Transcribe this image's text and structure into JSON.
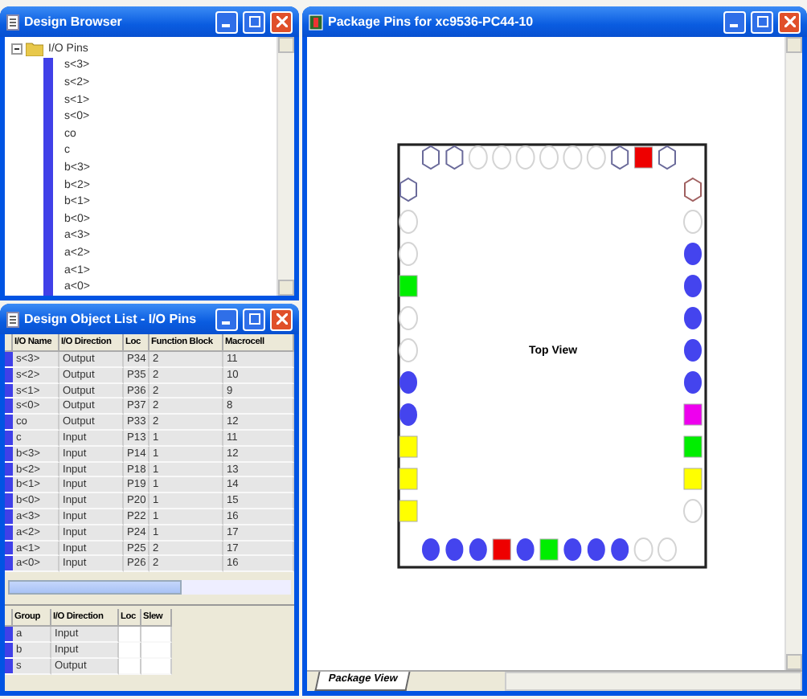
{
  "browser": {
    "title": "Design Browser",
    "tree": {
      "label": "I/O Pins",
      "expanded": true,
      "children": [
        {
          "label": "s<3>"
        },
        {
          "label": "s<2>"
        },
        {
          "label": "s<1>"
        },
        {
          "label": "s<0>"
        },
        {
          "label": "co"
        },
        {
          "label": "c"
        },
        {
          "label": "b<3>"
        },
        {
          "label": "b<2>"
        },
        {
          "label": "b<1>"
        },
        {
          "label": "b<0>"
        },
        {
          "label": "a<3>"
        },
        {
          "label": "a<2>"
        },
        {
          "label": "a<1>"
        },
        {
          "label": "a<0>"
        }
      ]
    }
  },
  "object_list": {
    "title": "Design Object List - I/O Pins",
    "columns": [
      "I/O Name",
      "I/O Direction",
      "Loc",
      "Function Block",
      "Macrocell"
    ],
    "rows": [
      [
        "s<3>",
        "Output",
        "P34",
        "2",
        "11"
      ],
      [
        "s<2>",
        "Output",
        "P35",
        "2",
        "10"
      ],
      [
        "s<1>",
        "Output",
        "P36",
        "2",
        "9"
      ],
      [
        "s<0>",
        "Output",
        "P37",
        "2",
        "8"
      ],
      [
        "co",
        "Output",
        "P33",
        "2",
        "12"
      ],
      [
        "c",
        "Input",
        "P13",
        "1",
        "11"
      ],
      [
        "b<3>",
        "Input",
        "P14",
        "1",
        "12"
      ],
      [
        "b<2>",
        "Input",
        "P18",
        "1",
        "13"
      ],
      [
        "b<1>",
        "Input",
        "P19",
        "1",
        "14"
      ],
      [
        "b<0>",
        "Input",
        "P20",
        "1",
        "15"
      ],
      [
        "a<3>",
        "Input",
        "P22",
        "1",
        "16"
      ],
      [
        "a<2>",
        "Input",
        "P24",
        "1",
        "17"
      ],
      [
        "a<1>",
        "Input",
        "P25",
        "2",
        "17"
      ],
      [
        "a<0>",
        "Input",
        "P26",
        "2",
        "16"
      ]
    ],
    "group_table": {
      "columns": [
        "Group",
        "I/O Direction",
        "Loc",
        "Slew"
      ],
      "rows": [
        {
          "group": "a",
          "direction": "Input"
        },
        {
          "group": "b",
          "direction": "Input"
        },
        {
          "group": "s",
          "direction": "Output"
        }
      ]
    }
  },
  "package": {
    "title": "Package Pins for xc9536-PC44-10",
    "label": "Top View",
    "pins": {
      "top": [
        {
          "kind": "hex",
          "color": "#6a6a9a"
        },
        {
          "kind": "hex",
          "color": "#6a6a9a"
        },
        {
          "kind": "empty"
        },
        {
          "kind": "empty"
        },
        {
          "kind": "empty"
        },
        {
          "kind": "empty"
        },
        {
          "kind": "empty"
        },
        {
          "kind": "empty"
        },
        {
          "kind": "hex",
          "color": "#6a6a9a"
        },
        {
          "kind": "square",
          "color": "#ee0000"
        },
        {
          "kind": "hex",
          "color": "#6a6a9a"
        }
      ],
      "left": [
        {
          "kind": "hex",
          "color": "#6a6a9a"
        },
        {
          "kind": "empty"
        },
        {
          "kind": "empty"
        },
        {
          "kind": "square",
          "color": "#00ee00"
        },
        {
          "kind": "empty"
        },
        {
          "kind": "empty"
        },
        {
          "kind": "filled",
          "color": "#4444ee"
        },
        {
          "kind": "filled",
          "color": "#4444ee"
        },
        {
          "kind": "square",
          "color": "#ffff00"
        },
        {
          "kind": "square",
          "color": "#ffff00"
        },
        {
          "kind": "square",
          "color": "#ffff00"
        }
      ],
      "right": [
        {
          "kind": "hex",
          "color": "#a06060"
        },
        {
          "kind": "empty"
        },
        {
          "kind": "filled",
          "color": "#4444ee"
        },
        {
          "kind": "filled",
          "color": "#4444ee"
        },
        {
          "kind": "filled",
          "color": "#4444ee"
        },
        {
          "kind": "filled",
          "color": "#4444ee"
        },
        {
          "kind": "filled",
          "color": "#4444ee"
        },
        {
          "kind": "square",
          "color": "#ee00ee"
        },
        {
          "kind": "square",
          "color": "#00ee00"
        },
        {
          "kind": "square",
          "color": "#ffff00"
        },
        {
          "kind": "empty"
        }
      ],
      "bottom": [
        {
          "kind": "filled",
          "color": "#4444ee"
        },
        {
          "kind": "filled",
          "color": "#4444ee"
        },
        {
          "kind": "filled",
          "color": "#4444ee"
        },
        {
          "kind": "square",
          "color": "#ee0000"
        },
        {
          "kind": "filled",
          "color": "#4444ee"
        },
        {
          "kind": "square",
          "color": "#00ee00"
        },
        {
          "kind": "filled",
          "color": "#4444ee"
        },
        {
          "kind": "filled",
          "color": "#4444ee"
        },
        {
          "kind": "filled",
          "color": "#4444ee"
        },
        {
          "kind": "empty"
        },
        {
          "kind": "empty"
        }
      ]
    },
    "tabs": [
      {
        "label": "Package View",
        "selected": true
      }
    ]
  }
}
